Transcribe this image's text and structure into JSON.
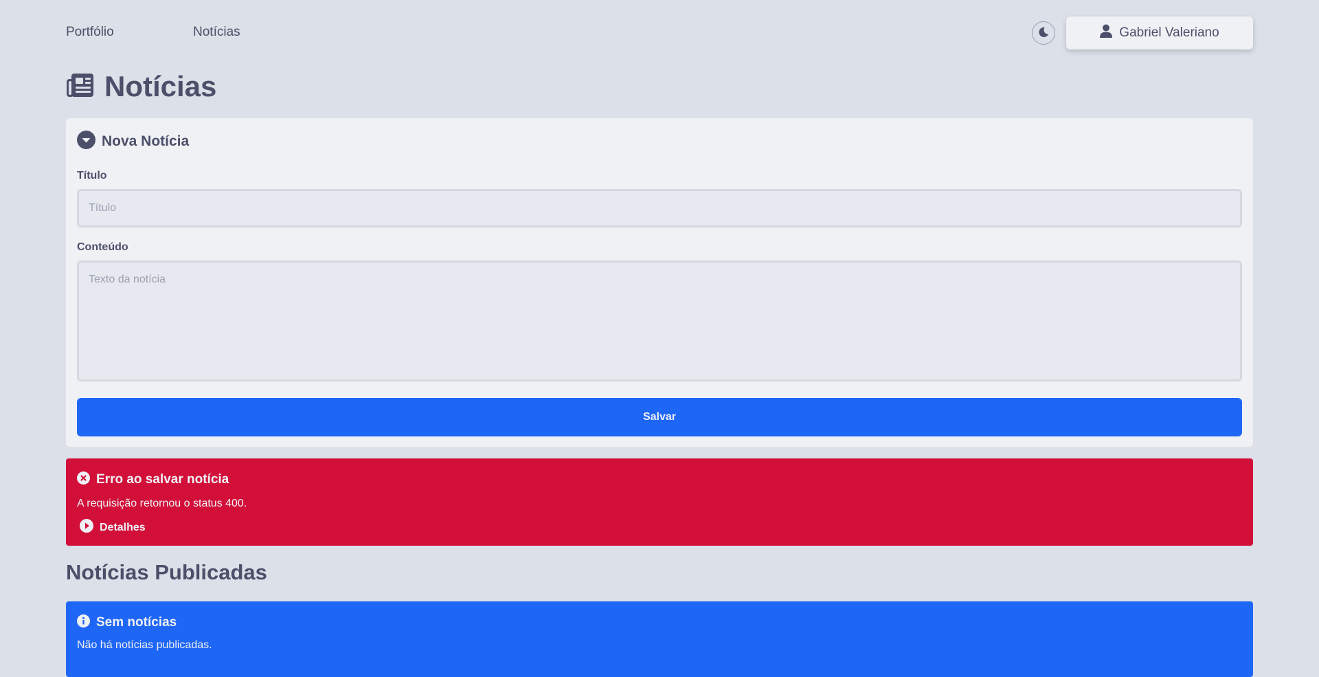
{
  "nav": {
    "links": [
      "Portfólio",
      "Notícias"
    ],
    "theme_toggle_icon": "moon-icon",
    "user": {
      "icon": "user-icon",
      "name": "Gabriel Valeriano"
    }
  },
  "page": {
    "title": "Notícias",
    "title_icon": "newspaper-icon"
  },
  "form": {
    "header": "Nova Notícia",
    "header_icon": "chevron-down-circle-icon",
    "title_label": "Título",
    "title_placeholder": "Título",
    "title_value": "",
    "content_label": "Conteúdo",
    "content_placeholder": "Texto da notícia",
    "content_value": "",
    "save_label": "Salvar"
  },
  "error_alert": {
    "icon": "x-circle-icon",
    "title": "Erro ao salvar notícia",
    "message": "A requisição retornou o status 400.",
    "details_icon": "play-circle-icon",
    "details_label": "Detalhes"
  },
  "published": {
    "title": "Notícias Publicadas",
    "empty_icon": "info-icon",
    "empty_title": "Sem notícias",
    "empty_message": "Não há notícias publicadas."
  },
  "colors": {
    "background": "#dce0e8",
    "card": "#eff1f5",
    "text": "#4c4f69",
    "primary": "#1e66f5",
    "error": "#d20f39"
  }
}
